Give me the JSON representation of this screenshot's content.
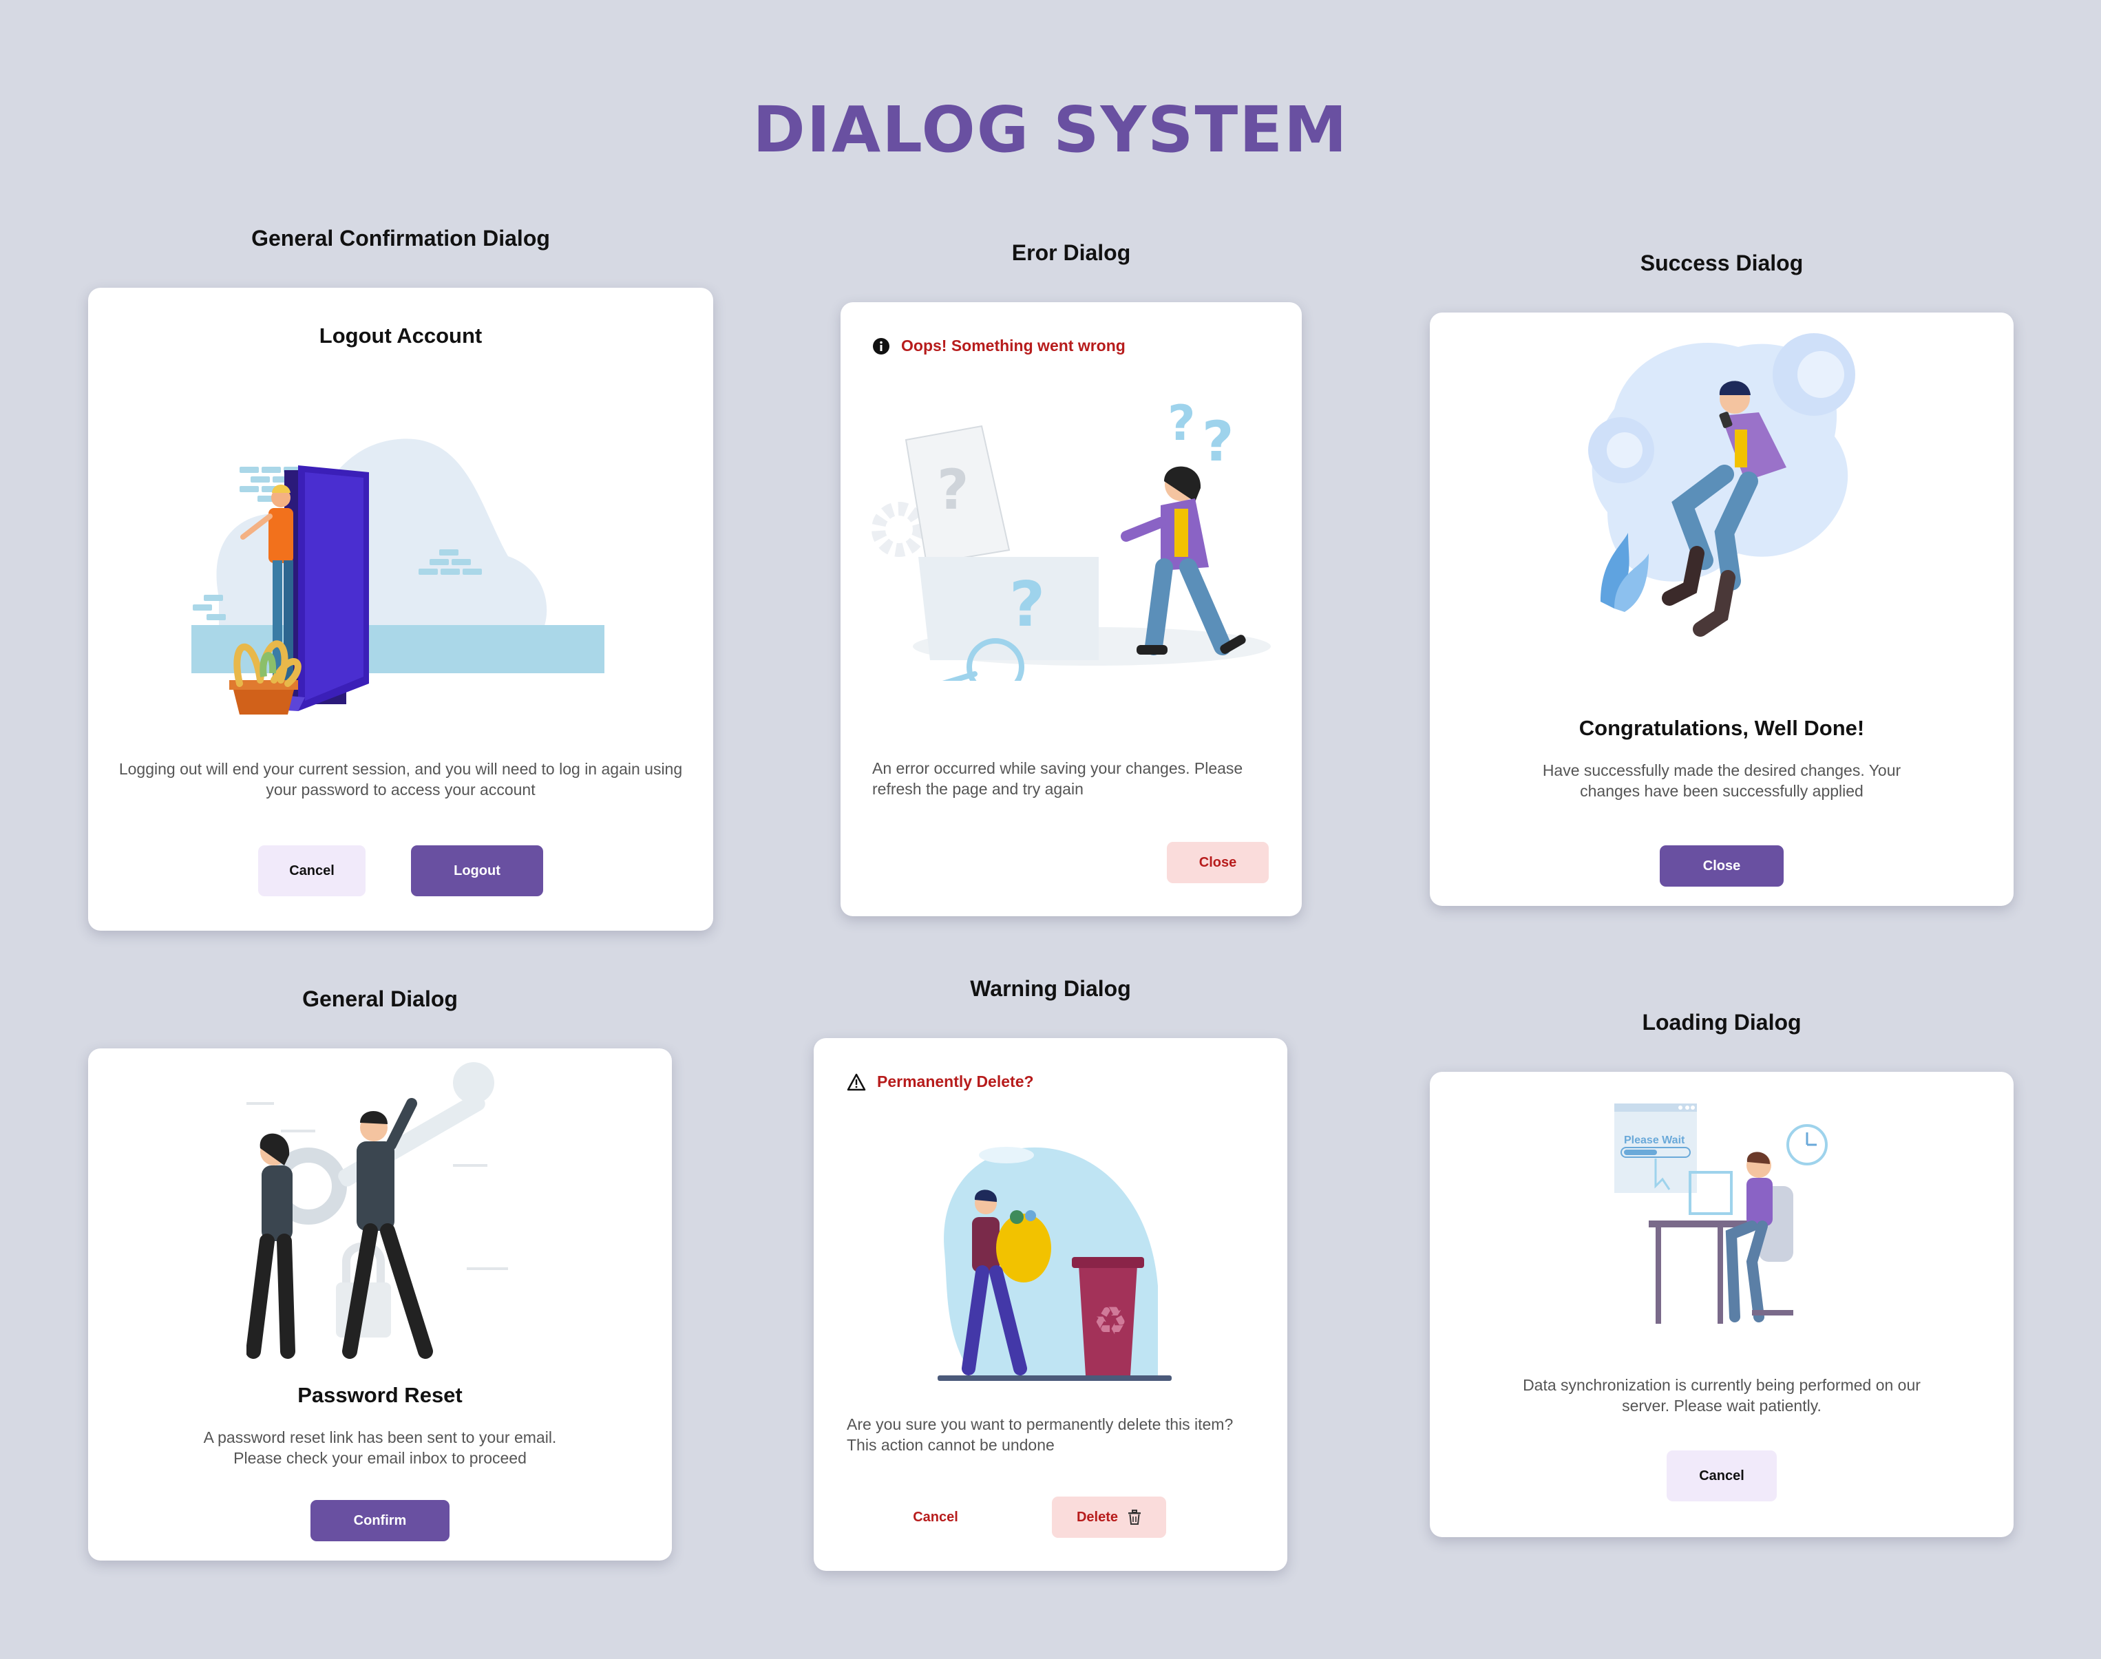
{
  "page": {
    "title": "DIALOG SYSTEM"
  },
  "sections": {
    "general_confirmation": "General Confirmation Dialog",
    "error": "Eror Dialog",
    "success": "Success Dialog",
    "general": "General Dialog",
    "warning": "Warning Dialog",
    "loading": "Loading Dialog"
  },
  "logout_dialog": {
    "title": "Logout Account",
    "body": "Logging out will end your current session, and you will need to log in again using your password to access your account",
    "cancel_label": "Cancel",
    "logout_label": "Logout"
  },
  "error_dialog": {
    "icon": "info-circle-icon",
    "title": "Oops! Something went wrong",
    "body": "An error occurred while saving your changes. Please refresh the page and try again",
    "close_label": "Close"
  },
  "success_dialog": {
    "title": "Congratulations, Well Done!",
    "body": "Have successfully made the desired changes. Your changes have been successfully applied",
    "close_label": "Close"
  },
  "general_dialog": {
    "title": "Password Reset",
    "body": "A password reset link has been sent to your email. Please check your email inbox to proceed",
    "confirm_label": "Confirm"
  },
  "warning_dialog": {
    "icon": "warning-triangle-icon",
    "title": "Permanently Delete?",
    "body": "Are you sure you want to permanently delete this item? This action cannot be undone",
    "cancel_label": "Cancel",
    "delete_label": "Delete",
    "delete_icon": "trash-icon"
  },
  "loading_dialog": {
    "screen_text": "Please Wait",
    "body": "Data synchronization is currently being performed on our server. Please wait patiently.",
    "cancel_label": "Cancel"
  },
  "colors": {
    "background": "#d6d9e3",
    "brand": "#6950a1",
    "danger": "#b71c1c",
    "danger_soft": "#fadcdb",
    "soft": "#f1eafa"
  }
}
